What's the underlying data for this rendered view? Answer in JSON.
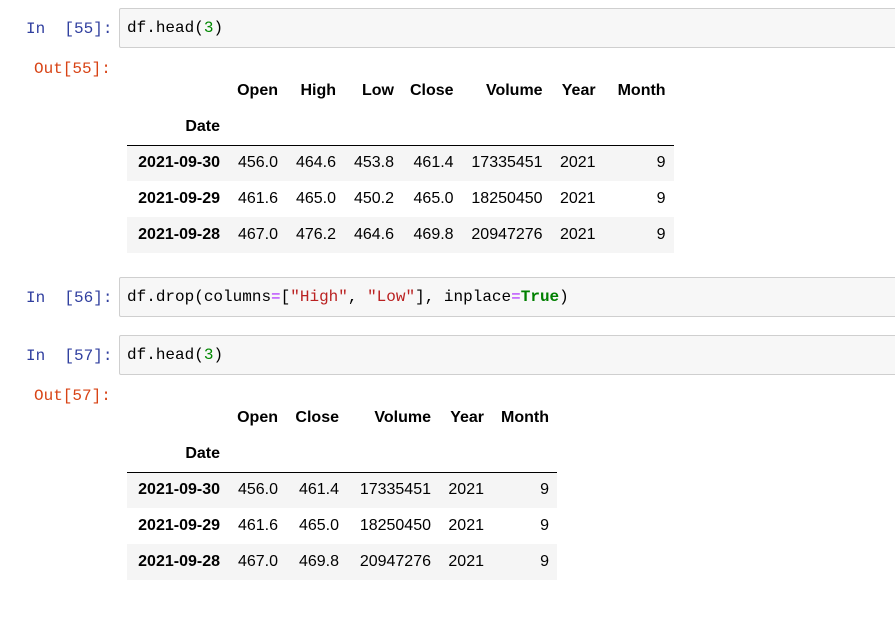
{
  "cells": [
    {
      "in_prompt": "In  [55]:",
      "code": {
        "obj": "df",
        "method": "head",
        "arg": "3"
      },
      "out_prompt": "Out[55]:"
    },
    {
      "in_prompt": "In  [56]:",
      "code": {
        "obj": "df",
        "method": "drop",
        "kw1": "columns",
        "s1": "\"High\"",
        "s2": "\"Low\"",
        "kw2": "inplace",
        "val": "True"
      }
    },
    {
      "in_prompt": "In  [57]:",
      "code": {
        "obj": "df",
        "method": "head",
        "arg": "3"
      },
      "out_prompt": "Out[57]:"
    }
  ],
  "table1": {
    "columns": [
      "Open",
      "High",
      "Low",
      "Close",
      "Volume",
      "Year",
      "Month"
    ],
    "index_name": "Date",
    "rows": [
      {
        "date": "2021-09-30",
        "values": [
          "456.0",
          "464.6",
          "453.8",
          "461.4",
          "17335451",
          "2021",
          "9"
        ]
      },
      {
        "date": "2021-09-29",
        "values": [
          "461.6",
          "465.0",
          "450.2",
          "465.0",
          "18250450",
          "2021",
          "9"
        ]
      },
      {
        "date": "2021-09-28",
        "values": [
          "467.0",
          "476.2",
          "464.6",
          "469.8",
          "20947276",
          "2021",
          "9"
        ]
      }
    ]
  },
  "table2": {
    "columns": [
      "Open",
      "Close",
      "Volume",
      "Year",
      "Month"
    ],
    "index_name": "Date",
    "rows": [
      {
        "date": "2021-09-30",
        "values": [
          "456.0",
          "461.4",
          "17335451",
          "2021",
          "9"
        ]
      },
      {
        "date": "2021-09-29",
        "values": [
          "461.6",
          "465.0",
          "18250450",
          "2021",
          "9"
        ]
      },
      {
        "date": "2021-09-28",
        "values": [
          "467.0",
          "469.8",
          "20947276",
          "2021",
          "9"
        ]
      }
    ]
  }
}
